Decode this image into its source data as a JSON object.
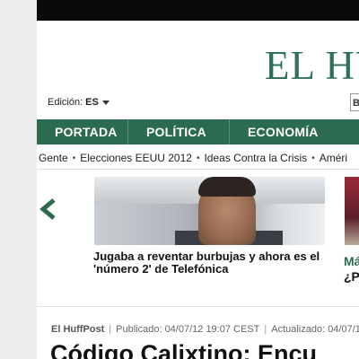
{
  "header": {
    "logo": "EL HUF",
    "edition_label": "Edición:",
    "edition_code": "ES",
    "search_partial": "B"
  },
  "nav": {
    "items": [
      {
        "label": "PORTADA"
      },
      {
        "label": "POLÍTICA"
      },
      {
        "label": "ECONOMÍA"
      }
    ]
  },
  "subnav": {
    "items": [
      {
        "label": "Gente"
      },
      {
        "label": "Elecciones EEUU 2012"
      },
      {
        "label": "Ideas Contra la Crisis"
      },
      {
        "label": "Améri"
      }
    ]
  },
  "carousel": {
    "headline": "Jugaba a reventar burbujas y ahora es el 'número 2' de Telefónica",
    "side_headline_1": "Má",
    "side_headline_2": "¿P"
  },
  "article": {
    "author": "El HuffPost",
    "published": "Publicado: 04/07/12 19:07 CEST",
    "updated": "Actualizado: 04/07/1",
    "title": "Código Calixtino: Encu"
  },
  "colors": {
    "brand_green": "#2b6b4f",
    "logo_green": "#2e7154"
  }
}
